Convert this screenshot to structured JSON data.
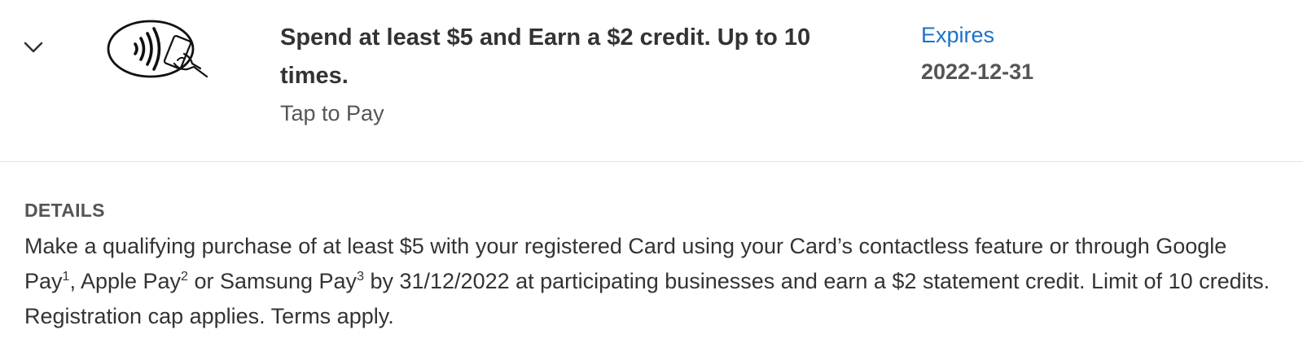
{
  "offer": {
    "title": "Spend at least $5 and Earn a $2 credit. Up to 10 times.",
    "category": "Tap to Pay",
    "logo_icon": "contactless-tap-to-pay-icon",
    "toggle_icon": "chevron-down-icon",
    "expires_label": "Expires",
    "expires_date": "2022-12-31"
  },
  "details": {
    "heading": "DETAILS",
    "part1": "Make a qualifying purchase of at least $5 with your registered Card using your Card’s contactless feature or through Google Pay",
    "sup1": "1",
    "part2": ", Apple Pay",
    "sup2": "2",
    "part3": " or Samsung Pay",
    "sup3": "3",
    "part4": " by 31/12/2022 at participating businesses and earn a $2 statement credit. Limit of 10 credits. Registration cap applies. Terms apply."
  },
  "colors": {
    "link": "#1a73c8",
    "text": "#333333",
    "muted": "#555555",
    "divider": "#e3e3e3"
  }
}
